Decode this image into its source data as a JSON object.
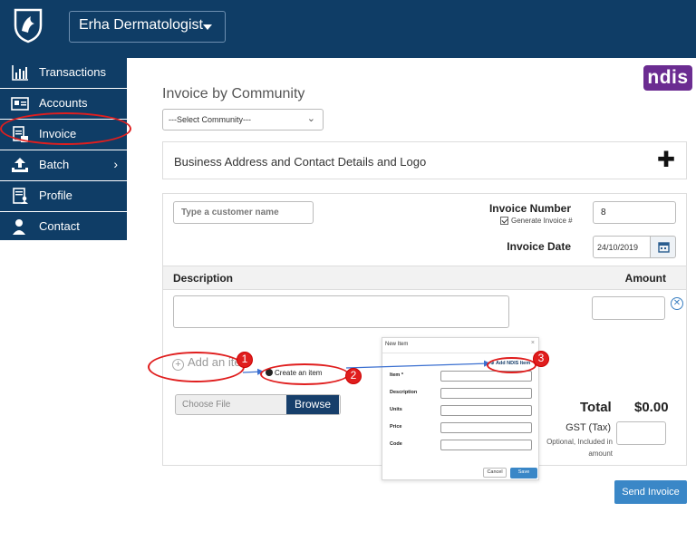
{
  "header": {
    "org_name": "Erha Dermatologist"
  },
  "sidebar": {
    "items": [
      {
        "label": "Transactions",
        "icon": "chart-icon"
      },
      {
        "label": "Accounts",
        "icon": "id-card-icon"
      },
      {
        "label": "Invoice",
        "icon": "invoice-icon"
      },
      {
        "label": "Batch",
        "icon": "upload-icon"
      },
      {
        "label": "Profile",
        "icon": "profile-doc-icon"
      },
      {
        "label": "Contact",
        "icon": "user-icon"
      }
    ]
  },
  "brand": {
    "ndis_logo": "ndis",
    "ndis_color": "#6b2c91",
    "nav_color": "#0f3d66"
  },
  "main": {
    "title": "Invoice by Community",
    "community_select": "---Select Community---",
    "business_panel": "Business Address and Contact Details and Logo",
    "customer_placeholder": "Type a customer name",
    "invoice_number_label": "Invoice Number",
    "generate_label": "Generate Invoice #",
    "invoice_number": "8",
    "invoice_date_label": "Invoice Date",
    "invoice_date": "24/10/2019",
    "description_header": "Description",
    "amount_header": "Amount",
    "add_item": "Add an item",
    "file_placeholder": "Choose File",
    "browse": "Browse",
    "total_label": "Total",
    "total_value": "$0.00",
    "gst_label": "GST (Tax)",
    "gst_note": "Optional, Included in amount",
    "send_invoice": "Send Invoice"
  },
  "callouts": {
    "create_item": "Create an item",
    "steps": [
      "1",
      "2",
      "3"
    ]
  },
  "modal": {
    "title": "New Item",
    "close": "×",
    "add_ndis_item": "Add NDIS Item",
    "fields": [
      "Item *",
      "Description",
      "Units",
      "Price",
      "Code"
    ],
    "cancel": "Cancel",
    "save": "Save"
  }
}
